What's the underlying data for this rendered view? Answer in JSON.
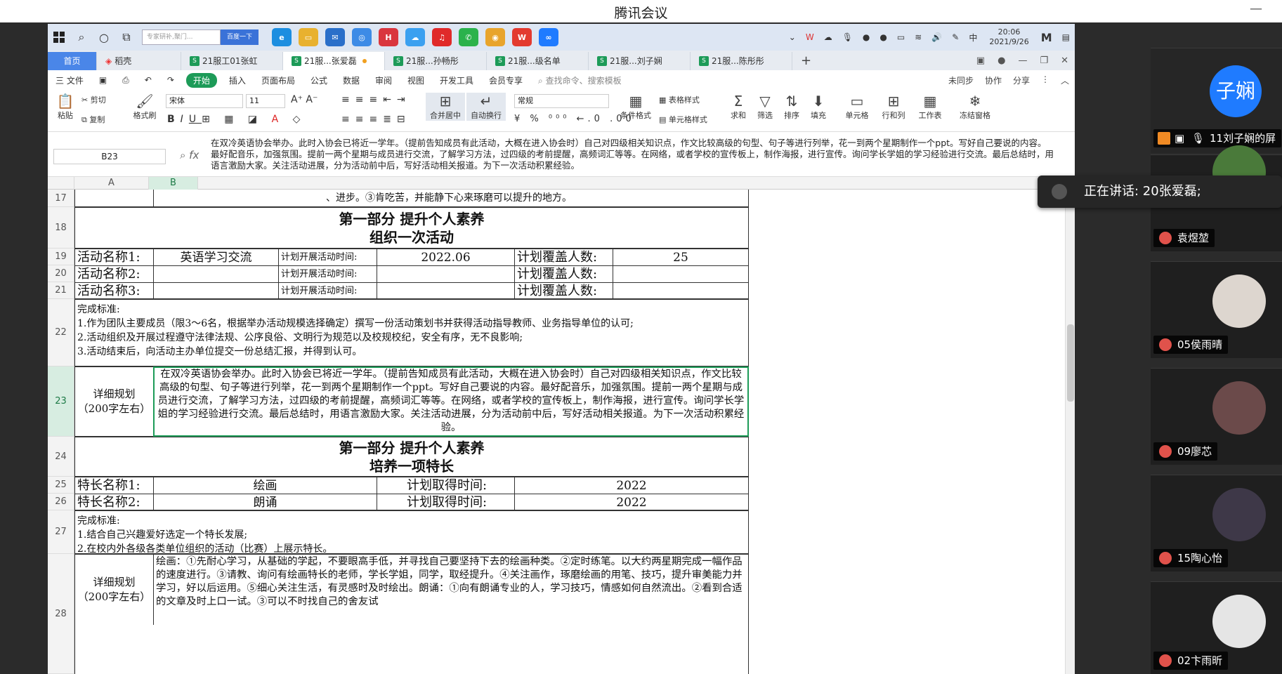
{
  "window": {
    "title": "腾讯会议",
    "minimize": "—"
  },
  "taskbar": {
    "search_placeholder": "专家研补,聚门...",
    "search_button": "百度一下",
    "apps": [
      "edge",
      "files",
      "mail",
      "browser",
      "huawei",
      "cloud",
      "netease-music",
      "wechat",
      "chrome",
      "wps",
      "meeting"
    ],
    "tray_ime": "中",
    "time": "20:06",
    "date": "2021/9/26"
  },
  "tabs": {
    "home": "首页",
    "items": [
      {
        "label": "稻壳",
        "type": "docer"
      },
      {
        "label": "21服工01张虹",
        "type": "sheet"
      },
      {
        "label": "21服...张爱磊",
        "type": "sheet",
        "active": true
      },
      {
        "label": "21服...孙畅彤",
        "type": "sheet"
      },
      {
        "label": "21服...级名单",
        "type": "sheet"
      },
      {
        "label": "21服...刘子娴",
        "type": "sheet"
      },
      {
        "label": "21服...陈彤彤",
        "type": "sheet"
      }
    ],
    "new_tab": "+"
  },
  "menu": {
    "file": "三 文件",
    "items": [
      "开始",
      "插入",
      "页面布局",
      "公式",
      "数据",
      "审阅",
      "视图",
      "开发工具",
      "会员专享"
    ],
    "search": "查找命令、搜索模板",
    "sync": "未同步",
    "collab": "协作",
    "share": "分享"
  },
  "ribbon": {
    "paste": "粘贴",
    "cut": "剪切",
    "copy": "复制",
    "format_painter": "格式刷",
    "font": "宋体",
    "size": "11",
    "merge": "合并居中",
    "wrap": "自动换行",
    "number_format": "常规",
    "cond_format": "条件格式",
    "table_style": "表格样式",
    "cell_style": "单元格样式",
    "sum": "求和",
    "filter": "筛选",
    "sort": "排序",
    "fill": "填充",
    "cell": "单元格",
    "rowcol": "行和列",
    "sheet": "工作表",
    "freeze": "冻结窗格"
  },
  "formula_bar": {
    "cell_ref": "B23",
    "fx": "fx",
    "content": "在双冷英语协会举办。此时入协会已将近一学年。（提前告知成员有此活动，大概在进入协会时）自己对四级相关知识点，作文比较高级的句型、句子等进行列举，花一到两个星期制作一个ppt。写好自己要说的内容。最好配音乐，加强氛围。提前一两个星期与成员进行交流，了解学习方法，过四级的考前提醒，高频词汇等等。在网络，或者学校的宣传板上，制作海报，进行宣传。询问学长学姐的学习经验进行交流。最后总结时，用语言激励大家。关注活动进展，分为活动前中后，写好活动相关报道。为下一次活动积累经验。"
  },
  "columns": [
    "A",
    "B"
  ],
  "rows": [
    "17",
    "18",
    "19",
    "20",
    "21",
    "22",
    "23",
    "24",
    "25",
    "26",
    "27",
    "28"
  ],
  "sheet": {
    "r17": "、进步。③肯吃苦，并能静下心来琢磨可以提升的地方。",
    "r18_l1": "第一部分  提升个人素养",
    "r18_l2": "组织一次活动",
    "r19": {
      "a": "活动名称1:",
      "b": "英语学习交流",
      "c": "计划开展活动时间:",
      "d": "2022.06",
      "e": "计划覆盖人数:",
      "f": "25"
    },
    "r20": {
      "a": "活动名称2:",
      "c": "计划开展活动时间:",
      "e": "计划覆盖人数:"
    },
    "r21": {
      "a": "活动名称3:",
      "c": "计划开展活动时间:",
      "e": "计划覆盖人数:"
    },
    "r22": [
      "完成标准:",
      "1.作为团队主要成员（限3～6名，根据举办活动规模选择确定）撰写一份活动策划书并获得活动指导教师、业务指导单位的认可;",
      "2.活动组织及开展过程遵守法律法规、公序良俗、文明行为规范以及校规校纪，安全有序，无不良影响;",
      "3.活动结束后，向活动主办单位提交一份总结汇报，并得到认可。"
    ],
    "r23_label": "详细规划\n（200字左右）",
    "r23_text": "在双冷英语协会举办。此时入协会已将近一学年。（提前告知成员有此活动，大概在进入协会时）自己对四级相关知识点，作文比较高级的句型、句子等进行列举，花一到两个星期制作一个ppt。写好自己要说的内容。最好配音乐，加强氛围。提前一两个星期与成员进行交流，了解学习方法，过四级的考前提醒，高频词汇等等。在网络，或者学校的宣传板上，制作海报，进行宣传。询问学长学姐的学习经验进行交流。最后总结时，用语言激励大家。关注活动进展，分为活动前中后，写好活动相关报道。为下一次活动积累经验。",
    "r24_l1": "第一部分  提升个人素养",
    "r24_l2": "培养一项特长",
    "r25": {
      "a": "特长名称1:",
      "b": "绘画",
      "c": "计划取得时间:",
      "d": "2022"
    },
    "r26": {
      "a": "特长名称2:",
      "b": "朗诵",
      "c": "计划取得时间:",
      "d": "2022"
    },
    "r27": [
      "完成标准:",
      "1.结合自己兴趣爱好选定一个特长发展;",
      "2.在校内外各级各类单位组织的活动（比赛）上展示特长。"
    ],
    "r28_label": "详细规划\n（200字左右）",
    "r28_text": "绘画：①先耐心学习，从基础的学起，不要眼高手低，并寻找自己要坚持下去的绘画种类。②定时练笔。以大约两星期完成一幅作品的速度进行。③请教、询问有绘画特长的老师，学长学姐，同学，取经提升。④关注画作，琢磨绘画的用笔、技巧，提升审美能力并学习，好以后运用。⑤细心关注生活，有灵感时及时绘出。朗诵：①向有朗诵专业的人，学习技巧，情感如何自然流出。②看到合适的文章及时上口一试。③可以不时找自己的舍友试"
  },
  "meeting": {
    "presenter_avatar_text": "子娴",
    "presenter_label": "11刘子娴的屏",
    "speaking": "正在讲话: 20张爱磊;",
    "participants": [
      "袁煜堃",
      "05侯雨晴",
      "09廖芯",
      "15陶心怡",
      "02卞雨昕"
    ]
  },
  "colors": {
    "accent_green": "#1d9b58",
    "meeting_blue": "#1f7bff",
    "muted_red": "#e0524b"
  }
}
